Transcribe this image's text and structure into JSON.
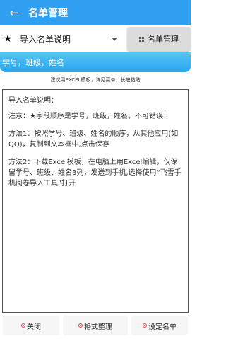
{
  "appbar": {
    "back_icon": "arrow-back-icon",
    "back_glyph": "←",
    "title": "名单管理"
  },
  "toolbar": {
    "selector_icon": "star-icon",
    "selector_glyph": "★",
    "selector_label": "导入名单说明",
    "manage_icon": "grid-icon",
    "manage_label": "名单管理"
  },
  "fields_bar": {
    "text": "学号，班级，姓名"
  },
  "hint": "建议用EXCEL模板，详见菜单，长按粘贴",
  "content": {
    "lines": [
      "导入名单说明：",
      "注意：★字段顺序是学号，班级，姓名，不可错误！",
      "方法1：按照学号、班级、姓名的顺序，从其他应用(如QQ)，复制到文本框中,点击保存",
      "方法2：下载Excel模板，在电脑上用Excel编辑，仅保留学号、班级、姓名3列，发送到手机,选择使用“飞雪手机阅卷导入工具”打开"
    ]
  },
  "bottom": {
    "close_label": "关闭",
    "format_label": "格式整理",
    "set_label": "设定名单",
    "icon": "radio-dot-icon"
  },
  "colors": {
    "primary": "#2f9ff1",
    "accent": "#e2435a",
    "manage_bg": "#dcdcdc"
  }
}
